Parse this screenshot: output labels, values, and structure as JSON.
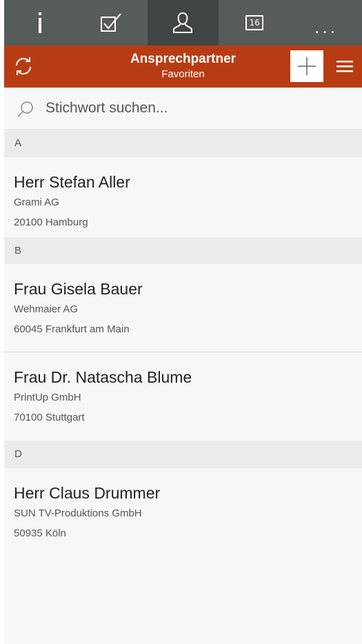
{
  "nav": {
    "tabs": [
      {
        "icon": "info-icon"
      },
      {
        "icon": "checkbox-icon"
      },
      {
        "icon": "contact-person-icon",
        "active": true
      },
      {
        "icon": "calendar-icon",
        "label": "16"
      },
      {
        "icon": "more-icon",
        "label": "..."
      }
    ]
  },
  "header": {
    "title": "Ansprechpartner",
    "subtitle": "Favoriten",
    "accent_color": "#b83c13"
  },
  "search": {
    "placeholder": "Stichwort suchen..."
  },
  "sections": [
    {
      "letter": "A",
      "contacts": [
        {
          "salutation": "Herr",
          "name": "Stefan Aller",
          "company": "Grami AG",
          "city": "20100 Hamburg"
        }
      ]
    },
    {
      "letter": "B",
      "contacts": [
        {
          "salutation": "Frau",
          "name": "Gisela Bauer",
          "company": "Wehmaier AG",
          "city": "60045 Frankfurt am Main"
        },
        {
          "salutation": "Frau Dr.",
          "name": "Natascha Blume",
          "company": "PrintUp GmbH",
          "city": "70100 Stuttgart"
        }
      ]
    },
    {
      "letter": "D",
      "contacts": [
        {
          "salutation": "Herr",
          "name": "Claus Drummer",
          "company": "SUN TV-Produktions GmbH",
          "city": "50935 Köln"
        }
      ]
    }
  ]
}
